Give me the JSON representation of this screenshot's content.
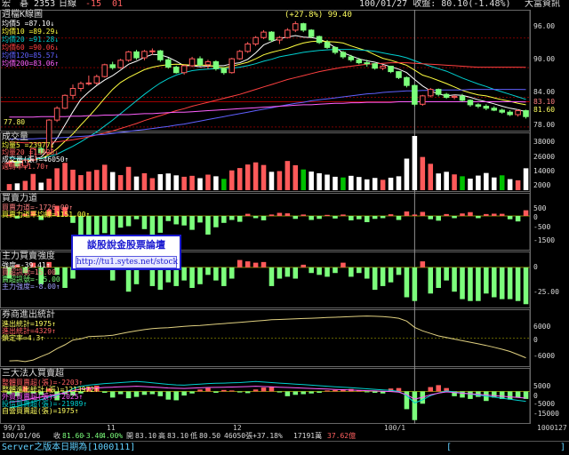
{
  "header": {
    "stock": "宏　碁 2353",
    "period": "日線",
    "v1": "-15",
    "v2": "01",
    "center": "100/01/27 收盤: 80.10(-1.48%)",
    "brand": "大富資訊"
  },
  "colors": {
    "up": "#ff5a5a",
    "down": "#7cff7c",
    "white_vol": "#ffffff",
    "green_vol": "#00c000",
    "ma5": "#ffffff",
    "ma10": "#ffff40",
    "ma20": "#00d0d0",
    "ma60": "#ff4040",
    "ma120": "#6060ff",
    "ma200": "#ff60ff",
    "grid": "#7a0000",
    "cursor": "#909090",
    "panel_border": "#666666"
  },
  "panels": {
    "price": {
      "title": "週檔K線圖",
      "legend": [
        "均價5 =87.10↓",
        "均價10 =89.29↓",
        "均價20 =91.28↓",
        "均價60 =90.06↓",
        "均價120=85.57↓",
        "均價200=83.06↑"
      ],
      "peak_label": "(+27.8%) 99.40",
      "low_label": "77.80",
      "ticks": [
        "96.00",
        "90.00",
        "84.00",
        "83.10",
        "81.60",
        "78.00"
      ]
    },
    "volume": {
      "title": "成交量",
      "legend": [
        "均量5 =23977↓",
        "均量20 =13823↓",
        "成交量(張)=46050↑",
        "週轉率=1.70↑"
      ],
      "ticks": [
        "38000",
        "26000",
        "14000",
        "2000"
      ]
    },
    "buysell": {
      "title": "買賣力道",
      "legend": [
        "買賣力道=-1726.00↑",
        "買賣力道平均線=1151.00↑"
      ],
      "ticks": [
        "500",
        "0",
        "-500",
        "-1500"
      ]
    },
    "main_force": {
      "title": "主力買賣強度",
      "legend": [
        "強度=-39.41↑",
        "買超訊號=15.00",
        "賣超訊號=-15.00",
        "主力強度=-8.00↑"
      ],
      "ticks": [
        "0",
        "-25.00"
      ]
    },
    "broker": {
      "title": "券商進出統計",
      "legend": [
        "進出統計=1975↑",
        "進出統計=4329↑",
        "鎖定率=4.3↑"
      ],
      "ticks": [
        "6000",
        "0",
        "-6000"
      ]
    },
    "institutional": {
      "title": "三大法人買賣超",
      "legend": [
        "整體買賣超(張)=-2203↑",
        "整體進出統計(張)=1213972↑",
        "外資買賣超(張)=-2025↑",
        "投信買賣超(張)=-21989↑",
        "自營買賣超(張)=1975↑"
      ],
      "ticks": [
        "5000",
        "0",
        "-5000",
        "-15000"
      ]
    }
  },
  "xaxis": {
    "labels": [
      "99/10",
      "11",
      "12",
      "100/1",
      "1000127"
    ]
  },
  "status": {
    "date": "100/01/06",
    "price_label": "收",
    "price": "81.60",
    "chg": "-3.40",
    "pct": "4.00%",
    "open_label": "開",
    "open": "83.10",
    "high_label": "高",
    "high": "83.10",
    "low_label": "低",
    "low": "80.50",
    "vol": "46050張+37.18%",
    "amount": "17191萬",
    "amount2": "37.62億",
    "server": "Server之版本日期為[1000111]",
    "bracket": "[",
    "bracket2": "]"
  },
  "watermark": {
    "title": "談股說金股票論壇",
    "url": "http://tu1.sytes.net/stock"
  },
  "chart_data": {
    "type": "candlestick",
    "title": "週檔K線圖",
    "ylim": [
      77.8,
      101
    ],
    "candles": [
      [
        70.6,
        71.2,
        70.0,
        70.8
      ],
      [
        70.8,
        71.5,
        69.8,
        70.1
      ],
      [
        70.1,
        71.6,
        69.4,
        71.3
      ],
      [
        71.3,
        73.8,
        71.0,
        73.6
      ],
      [
        73.6,
        74.0,
        72.4,
        72.8
      ],
      [
        72.8,
        79.6,
        72.6,
        79.4
      ],
      [
        79.4,
        82.2,
        79.0,
        81.8
      ],
      [
        81.8,
        84.6,
        81.6,
        84.4
      ],
      [
        84.4,
        86.6,
        83.6,
        85.8
      ],
      [
        85.8,
        87.2,
        85.2,
        86.8
      ],
      [
        86.8,
        88.4,
        86.4,
        86.9
      ],
      [
        86.9,
        88.6,
        86.5,
        88.2
      ],
      [
        88.2,
        90.8,
        88.0,
        90.6
      ],
      [
        90.6,
        91.2,
        89.6,
        90.0
      ],
      [
        90.0,
        91.8,
        89.8,
        91.5
      ],
      [
        91.5,
        93.4,
        91.2,
        93.2
      ],
      [
        93.2,
        93.6,
        91.6,
        92.0
      ],
      [
        92.0,
        93.6,
        91.5,
        93.3
      ],
      [
        93.3,
        93.9,
        92.6,
        93.4
      ],
      [
        93.4,
        93.6,
        91.2,
        91.6
      ],
      [
        91.6,
        92.0,
        89.8,
        90.1
      ],
      [
        90.1,
        90.4,
        88.8,
        89.0
      ],
      [
        89.0,
        90.6,
        88.6,
        90.4
      ],
      [
        90.4,
        92.2,
        90.1,
        91.8
      ],
      [
        91.8,
        92.3,
        90.3,
        90.6
      ],
      [
        90.6,
        91.6,
        89.8,
        91.2
      ],
      [
        91.2,
        91.5,
        89.4,
        89.8
      ],
      [
        89.8,
        90.1,
        88.6,
        89.0
      ],
      [
        89.0,
        92.0,
        88.8,
        91.8
      ],
      [
        91.8,
        93.6,
        91.6,
        93.3
      ],
      [
        93.3,
        95.2,
        93.0,
        94.8
      ],
      [
        94.8,
        96.4,
        94.4,
        96.1
      ],
      [
        96.1,
        97.6,
        95.8,
        97.2
      ],
      [
        97.2,
        97.4,
        95.2,
        95.6
      ],
      [
        95.6,
        96.4,
        94.8,
        96.1
      ],
      [
        96.1,
        98.0,
        95.9,
        97.6
      ],
      [
        97.6,
        99.4,
        97.2,
        98.9
      ],
      [
        98.9,
        99.1,
        97.2,
        97.6
      ],
      [
        97.6,
        97.8,
        96.0,
        96.3
      ],
      [
        96.3,
        96.5,
        94.8,
        95.1
      ],
      [
        95.1,
        95.6,
        93.8,
        94.1
      ],
      [
        94.1,
        94.3,
        92.7,
        93.1
      ],
      [
        93.1,
        93.4,
        91.8,
        92.2
      ],
      [
        92.2,
        92.6,
        91.2,
        91.6
      ],
      [
        91.6,
        92.0,
        90.7,
        91.0
      ],
      [
        91.0,
        91.6,
        90.2,
        90.8
      ],
      [
        90.8,
        90.9,
        89.6,
        89.9
      ],
      [
        89.9,
        90.6,
        89.5,
        90.3
      ],
      [
        90.3,
        90.4,
        88.9,
        89.2
      ],
      [
        89.2,
        89.3,
        87.7,
        88.0
      ],
      [
        88.0,
        88.2,
        86.0,
        86.4
      ],
      [
        86.4,
        86.6,
        82.2,
        82.6
      ],
      [
        82.6,
        84.5,
        82.3,
        84.3
      ],
      [
        84.3,
        85.9,
        84.0,
        85.6
      ],
      [
        85.6,
        85.8,
        84.2,
        84.6
      ],
      [
        84.6,
        84.9,
        83.7,
        84.0
      ],
      [
        84.0,
        84.5,
        83.6,
        84.2
      ],
      [
        84.2,
        84.7,
        83.1,
        83.4
      ],
      [
        83.4,
        83.6,
        82.1,
        82.5
      ],
      [
        82.5,
        82.8,
        81.8,
        82.2
      ],
      [
        82.2,
        82.6,
        81.4,
        81.8
      ],
      [
        81.8,
        82.2,
        81.2,
        81.4
      ],
      [
        81.4,
        81.7,
        80.7,
        81.0
      ],
      [
        81.0,
        81.4,
        80.2,
        80.5
      ],
      [
        80.5,
        81.6,
        80.1,
        81.3
      ],
      [
        81.3,
        81.5,
        79.7,
        80.1
      ]
    ],
    "series": [
      {
        "name": "均價5",
        "values": [
          71.0,
          70.8,
          70.8,
          71.4,
          71.9,
          73.6,
          75.7,
          78.4,
          81.1,
          83.6,
          85.1,
          86.4,
          87.5,
          88.4,
          89.5,
          90.7,
          91.3,
          92.1,
          92.7,
          92.6,
          92.1,
          91.3,
          90.4,
          90.4,
          90.2,
          90.3,
          90.4,
          90.4,
          90.8,
          91.0,
          91.7,
          93.0,
          94.6,
          95.3,
          95.9,
          96.2,
          96.5,
          96.2,
          96.1,
          95.8,
          95.1,
          94.1,
          93.0,
          92.4,
          91.8,
          91.4,
          91.1,
          90.7,
          90.2,
          89.7,
          89.0,
          87.6,
          86.3,
          85.3,
          84.7,
          84.3,
          84.5,
          84.4,
          84.0,
          83.5,
          83.1,
          82.7,
          82.2,
          81.8,
          81.5,
          81.1
        ]
      },
      {
        "name": "均價10",
        "values": [
          71.2,
          71.0,
          71.0,
          71.4,
          71.6,
          72.4,
          73.6,
          75.1,
          76.6,
          78.4,
          80.1,
          81.9,
          83.8,
          85.6,
          87.0,
          88.0,
          88.8,
          89.6,
          90.1,
          90.4,
          90.6,
          90.7,
          90.6,
          90.5,
          90.5,
          90.5,
          90.2,
          90.0,
          90.3,
          90.7,
          91.1,
          91.8,
          92.6,
          93.1,
          93.5,
          93.9,
          94.5,
          95.0,
          95.3,
          95.4,
          95.3,
          95.2,
          95.0,
          94.4,
          93.9,
          93.4,
          92.6,
          91.9,
          91.5,
          91.0,
          90.5,
          89.5,
          88.5,
          88.0,
          87.4,
          86.8,
          86.1,
          85.4,
          84.9,
          84.5,
          84.3,
          83.9,
          83.5,
          83.2,
          82.8,
          82.5
        ]
      },
      {
        "name": "均價20",
        "values": [
          71.8,
          71.6,
          71.5,
          71.6,
          71.6,
          72.0,
          72.5,
          73.3,
          74.1,
          75.0,
          76.0,
          77.0,
          78.2,
          79.4,
          80.7,
          82.0,
          83.3,
          84.6,
          85.8,
          86.9,
          87.8,
          88.5,
          89.0,
          89.4,
          89.6,
          89.7,
          89.8,
          89.8,
          89.9,
          90.1,
          90.4,
          90.8,
          91.3,
          91.7,
          92.2,
          92.5,
          92.8,
          93.1,
          93.3,
          93.5,
          93.6,
          93.7,
          93.7,
          93.7,
          93.6,
          93.5,
          93.3,
          93.0,
          92.7,
          92.4,
          92.0,
          91.4,
          90.8,
          90.3,
          89.8,
          89.3,
          88.6,
          87.9,
          87.3,
          86.7,
          86.2,
          85.6,
          85.1,
          84.6,
          84.1,
          83.6
        ]
      },
      {
        "name": "均價60",
        "values": [
          75.0,
          74.9,
          74.8,
          74.8,
          74.8,
          74.9,
          75.0,
          75.2,
          75.4,
          75.7,
          76.0,
          76.4,
          76.8,
          77.2,
          77.7,
          78.2,
          78.7,
          79.3,
          79.8,
          80.3,
          80.8,
          81.3,
          81.7,
          82.2,
          82.6,
          83.0,
          83.4,
          83.8,
          84.2,
          84.6,
          85.1,
          85.6,
          86.1,
          86.6,
          87.1,
          87.6,
          88.0,
          88.4,
          88.8,
          89.2,
          89.5,
          89.8,
          90.1,
          90.3,
          90.5,
          90.7,
          90.8,
          90.9,
          91.0,
          91.0,
          91.0,
          90.9,
          90.8,
          90.7,
          90.6,
          90.5,
          90.4,
          90.3,
          90.2,
          90.1,
          90.1,
          90.1,
          90.1,
          90.1,
          90.1,
          90.06
        ]
      },
      {
        "name": "均價120",
        "values": [
          75.6,
          75.6,
          75.6,
          75.6,
          75.7,
          75.7,
          75.8,
          75.9,
          76.0,
          76.1,
          76.2,
          76.4,
          76.5,
          76.7,
          76.9,
          77.1,
          77.3,
          77.5,
          77.7,
          77.9,
          78.1,
          78.4,
          78.6,
          78.9,
          79.2,
          79.5,
          79.8,
          80.1,
          80.4,
          80.7,
          81.0,
          81.3,
          81.6,
          81.9,
          82.2,
          82.5,
          82.8,
          83.0,
          83.3,
          83.5,
          83.7,
          83.9,
          84.1,
          84.3,
          84.5,
          84.7,
          84.8,
          85.0,
          85.1,
          85.2,
          85.3,
          85.3,
          85.4,
          85.4,
          85.5,
          85.5,
          85.5,
          85.5,
          85.6,
          85.6,
          85.6,
          85.6,
          85.6,
          85.6,
          85.6,
          85.57
        ]
      },
      {
        "name": "均價200",
        "values": [
          80.0,
          80.0,
          80.0,
          80.0,
          80.1,
          80.1,
          80.1,
          80.1,
          80.2,
          80.2,
          80.3,
          80.3,
          80.4,
          80.4,
          80.5,
          80.5,
          80.6,
          80.7,
          80.7,
          80.8,
          80.9,
          81.0,
          81.0,
          81.1,
          81.2,
          81.3,
          81.4,
          81.5,
          81.6,
          81.7,
          81.8,
          81.9,
          82.0,
          82.1,
          82.2,
          82.3,
          82.4,
          82.5,
          82.5,
          82.6,
          82.7,
          82.8,
          82.8,
          82.9,
          82.9,
          83.0,
          83.0,
          83.0,
          83.0,
          83.1,
          83.1,
          83.1,
          83.1,
          83.1,
          83.1,
          83.1,
          83.1,
          83.1,
          83.1,
          83.1,
          83.1,
          83.1,
          83.1,
          83.1,
          83.1,
          83.06
        ]
      }
    ],
    "volume": [
      5200,
      5800,
      7900,
      13800,
      6400,
      9800,
      18600,
      23200,
      17400,
      12800,
      15800,
      17200,
      21600,
      15400,
      12800,
      19800,
      11600,
      14400,
      10200,
      13600,
      14200,
      12600,
      11400,
      12200,
      10200,
      13200,
      11800,
      9600,
      16800,
      18800,
      21800,
      23600,
      21400,
      15600,
      16200,
      24800,
      21200,
      17600,
      15800,
      14400,
      13200,
      11400,
      10800,
      12200,
      11200,
      9200,
      10400,
      8800,
      10600,
      11800,
      26800,
      46050,
      28200,
      22400,
      14200,
      15600,
      13400,
      11800,
      9800,
      12400,
      14600,
      10800,
      12600,
      9400,
      8400,
      18600
    ],
    "buy_sell": [
      90,
      -140,
      180,
      420,
      -220,
      520,
      860,
      740,
      -380,
      -1200,
      -1480,
      -1680,
      -940,
      -1560,
      -640,
      -560,
      -180,
      -720,
      -1050,
      -920,
      -280,
      -460,
      -520,
      -760,
      -360,
      -1020,
      -620,
      -380,
      -220,
      -320,
      180,
      -120,
      -240,
      120,
      260,
      220,
      -160,
      120,
      -220,
      -160,
      90,
      -140,
      120,
      -240,
      -180,
      -340,
      -160,
      -120,
      140,
      -220,
      380,
      120,
      340,
      -180,
      -260,
      160,
      -120,
      210,
      320,
      -120,
      160,
      190,
      180,
      -180,
      -300,
      480
    ],
    "main_force": [
      -12,
      8,
      -6,
      14,
      -18,
      16,
      -8,
      -22,
      -12,
      18,
      28,
      24,
      16,
      -14,
      12,
      -26,
      -18,
      8,
      -20,
      -24,
      -16,
      -20,
      -14,
      -22,
      -18,
      -8,
      -14,
      -20,
      -12,
      22,
      18,
      14,
      16,
      -20,
      -12,
      -10,
      -12,
      8,
      -6,
      -8,
      -10,
      -6,
      14,
      -10,
      -6,
      -12,
      -24,
      -20,
      -16,
      -8,
      -32,
      -36,
      18,
      -28,
      -22,
      -14,
      -26,
      -34,
      -36,
      -36,
      -28,
      -32,
      -34,
      -34,
      -36,
      -39.41
    ],
    "broker_line": [
      -7200,
      -7100,
      -7400,
      -6900,
      -5800,
      -4800,
      -3300,
      -2100,
      -600,
      -200,
      500,
      600,
      700,
      900,
      1400,
      1900,
      2300,
      2700,
      3000,
      3200,
      3300,
      3500,
      3700,
      3900,
      4000,
      4200,
      4400,
      4600,
      4800,
      5000,
      5200,
      5400,
      5600,
      5800,
      5900,
      6000,
      6100,
      6200,
      6300,
      6400,
      6500,
      6600,
      6700,
      6800,
      6900,
      7000,
      6900,
      6800,
      6600,
      6300,
      5400,
      3400,
      2300,
      1500,
      700,
      200,
      -300,
      -800,
      -1300,
      -1800,
      -2300,
      -2900,
      -3500,
      -4200,
      -5200,
      -6200
    ],
    "institutional": [
      -800,
      -1400,
      2200,
      -600,
      -1000,
      1200,
      -2600,
      -800,
      -1200,
      -600,
      1800,
      2400,
      -400,
      -1800,
      -800,
      -2000,
      -1600,
      -1000,
      -800,
      -1400,
      -2400,
      -2600,
      -1200,
      -600,
      800,
      1400,
      -400,
      600,
      400,
      -300,
      -500,
      800,
      1600,
      1800,
      -300,
      -1400,
      -1000,
      -800,
      -600,
      -400,
      400,
      600,
      800,
      1000,
      400,
      -200,
      -400,
      -600,
      1200,
      1400,
      -5200,
      -8400,
      -3600,
      1800,
      2600,
      1400,
      -1400,
      -1800,
      -2200,
      -1600,
      -2800,
      -1800,
      -2200,
      -2400,
      -1800,
      -2203
    ],
    "institutional_line": [
      -6200,
      -5800,
      -4900,
      -4000,
      -3100,
      -2200,
      -1400,
      -400,
      1000,
      2000,
      2400,
      2700,
      3000,
      3200,
      3400,
      3600,
      3800,
      3600,
      3300,
      3000,
      2700,
      2500,
      2400,
      2600,
      2800,
      3000,
      3100,
      3200,
      3300,
      3400,
      3600,
      3800,
      3600,
      3400,
      3200,
      3000,
      2800,
      2600,
      2400,
      2200,
      2000,
      1800,
      1600,
      1400,
      1200,
      1000,
      800,
      600,
      400,
      0,
      -1600,
      -4400,
      -3200,
      -1600,
      -600,
      200,
      -200,
      -600,
      -1000,
      -1400,
      -1800,
      -2200,
      -2600,
      -3000,
      -3400,
      -3800
    ]
  }
}
